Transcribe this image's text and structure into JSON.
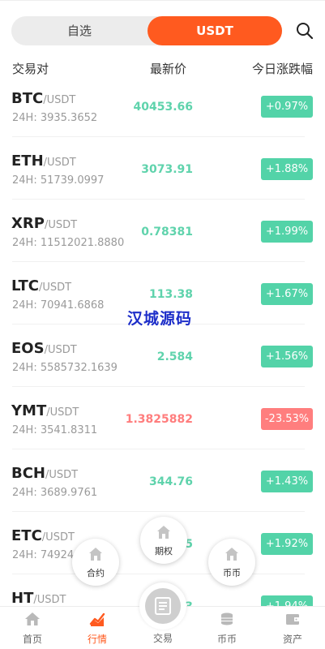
{
  "tabs": {
    "left": "自选",
    "right": "USDT"
  },
  "header": {
    "pair": "交易对",
    "price": "最新价",
    "change": "今日涨跌幅"
  },
  "rows": [
    {
      "base": "BTC",
      "quote": "/USDT",
      "volume": "24H: 3935.3652",
      "price": "40453.66",
      "change": "+0.97%",
      "trend": "up"
    },
    {
      "base": "ETH",
      "quote": "/USDT",
      "volume": "24H: 51739.0997",
      "price": "3073.91",
      "change": "+1.88%",
      "trend": "up"
    },
    {
      "base": "XRP",
      "quote": "/USDT",
      "volume": "24H: 11512021.8880",
      "price": "0.78381",
      "change": "+1.99%",
      "trend": "up"
    },
    {
      "base": "LTC",
      "quote": "/USDT",
      "volume": "24H: 70941.6868",
      "price": "113.38",
      "change": "+1.67%",
      "trend": "up"
    },
    {
      "base": "EOS",
      "quote": "/USDT",
      "volume": "24H: 5585732.1639",
      "price": "2.584",
      "change": "+1.56%",
      "trend": "up"
    },
    {
      "base": "YMT",
      "quote": "/USDT",
      "volume": "24H: 3541.8311",
      "price": "1.3825882",
      "change": "-23.53%",
      "trend": "down"
    },
    {
      "base": "BCH",
      "quote": "/USDT",
      "volume": "24H: 3689.9761",
      "price": "344.76",
      "change": "+1.43%",
      "trend": "up"
    },
    {
      "base": "ETC",
      "quote": "/USDT",
      "volume": "24H: 74924.9",
      "price": "5",
      "change": "+1.92%",
      "trend": "up"
    },
    {
      "base": "HT",
      "quote": "/USDT",
      "volume": "",
      "price": "3",
      "change": "+1.94%",
      "trend": "up"
    }
  ],
  "watermark": "汉城源码",
  "float_menu": {
    "contract": "合约",
    "options": "期权",
    "coin": "币币"
  },
  "nav": {
    "home": "首页",
    "market": "行情",
    "trade": "交易",
    "coin": "币币",
    "assets": "资产"
  },
  "colors": {
    "accent": "#ff5a1f",
    "up": "#53d3a8",
    "down": "#ff7e7e"
  }
}
